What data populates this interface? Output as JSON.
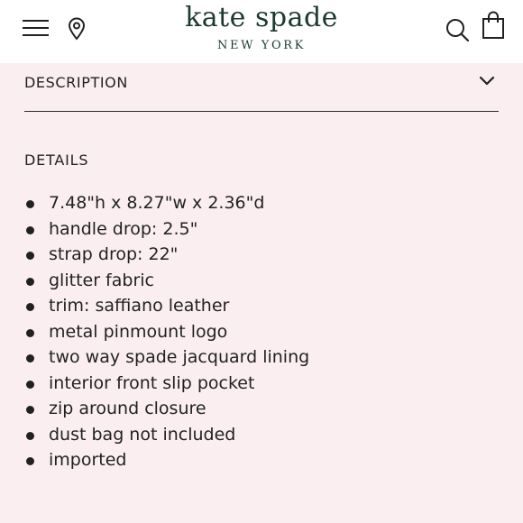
{
  "header": {
    "logo_main": "kate spade",
    "logo_sub": "NEW YORK",
    "icons": [
      "menu-icon",
      "location-pin-icon",
      "search-icon",
      "shopping-bag-icon"
    ]
  },
  "accordion": {
    "description_label": "DESCRIPTION"
  },
  "details": {
    "heading": "DETAILS",
    "items": [
      "7.48\"h x 8.27\"w x 2.36\"d",
      "handle drop: 2.5\"",
      "strap drop: 22\"",
      "glitter fabric",
      "trim: saffiano leather",
      "metal pinmount logo",
      "two way spade jacquard lining",
      "interior front slip pocket",
      "zip around closure",
      "dust bag not included",
      "imported"
    ]
  },
  "colors": {
    "page_background": "#fbeef0",
    "header_background": "#ffffff",
    "brand": "#1c3b2e",
    "text": "#1f2221"
  }
}
